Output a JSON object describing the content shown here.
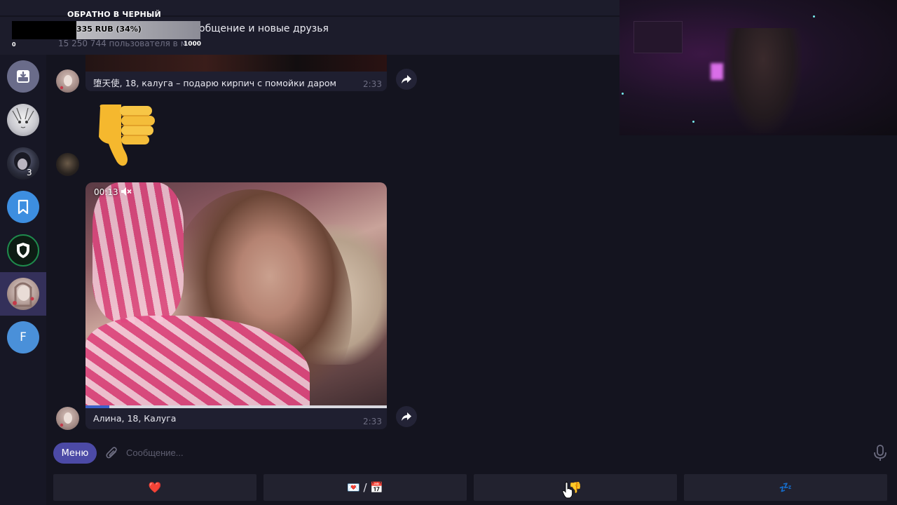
{
  "header": {
    "title": "общение и новые друзья",
    "subtitle": "15 250 744 пользователя в м"
  },
  "donation": {
    "title": "ОБРАТНО В ЧЕРНЫЙ",
    "amount": "335 RUB (34%)",
    "progress_percent": 34,
    "min": "0",
    "max": "1000"
  },
  "sidebar": {
    "items": [
      {
        "name": "archive",
        "icon": "archive-icon"
      },
      {
        "name": "manga-avatar"
      },
      {
        "name": "dark-avatar",
        "badge": "3"
      },
      {
        "name": "saved",
        "icon": "bookmark-icon"
      },
      {
        "name": "shield",
        "icon": "shield-icon"
      },
      {
        "name": "active-chat"
      },
      {
        "name": "letter-avatar",
        "letter": "F"
      }
    ]
  },
  "messages": [
    {
      "text": "堕天使, 18, калуга – подарю кирпич с помойки даром",
      "time": "2:33"
    },
    {
      "emoji": "👎"
    },
    {
      "video_time": "00:13",
      "video_progress_fraction": 0.08,
      "text": "Алина, 18, Калуга",
      "time": "2:33"
    }
  ],
  "compose": {
    "menu_label": "Меню",
    "placeholder": "Сообщение..."
  },
  "keyboard": [
    {
      "label": "❤️"
    },
    {
      "label": "💌 / 📅"
    },
    {
      "label": "👎"
    },
    {
      "label": "💤"
    }
  ],
  "colors": {
    "background": "#14141f",
    "header": "#1c1c2b",
    "accent": "#4c4aa6",
    "active_item": "#34305a"
  }
}
